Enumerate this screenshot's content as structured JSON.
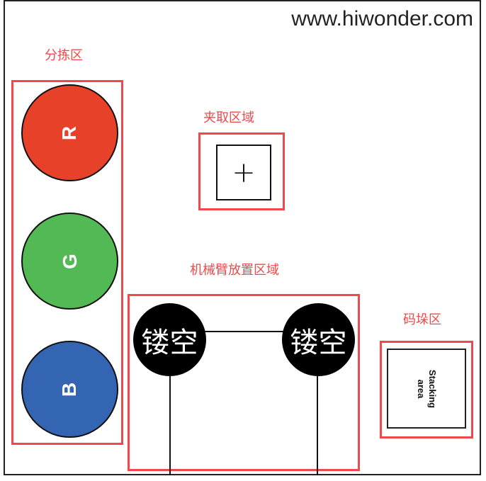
{
  "watermark": "www.hiwonder.com",
  "zones": {
    "sorting": {
      "label": "分拣区",
      "circles": [
        {
          "letter": "R",
          "color": "#e8412a"
        },
        {
          "letter": "G",
          "color": "#52b954"
        },
        {
          "letter": "B",
          "color": "#3465b3"
        }
      ]
    },
    "gripping": {
      "label": "夹取区域",
      "marker": "+"
    },
    "arm": {
      "label": "机械臂放置区域",
      "hollow_left": "镂空",
      "hollow_right": "镂空"
    },
    "stacking": {
      "label": "码垛区",
      "text_line1": "Stacking",
      "text_line2": "area"
    }
  },
  "colors": {
    "accent_red": "#f0484b",
    "outline": "#111111"
  }
}
